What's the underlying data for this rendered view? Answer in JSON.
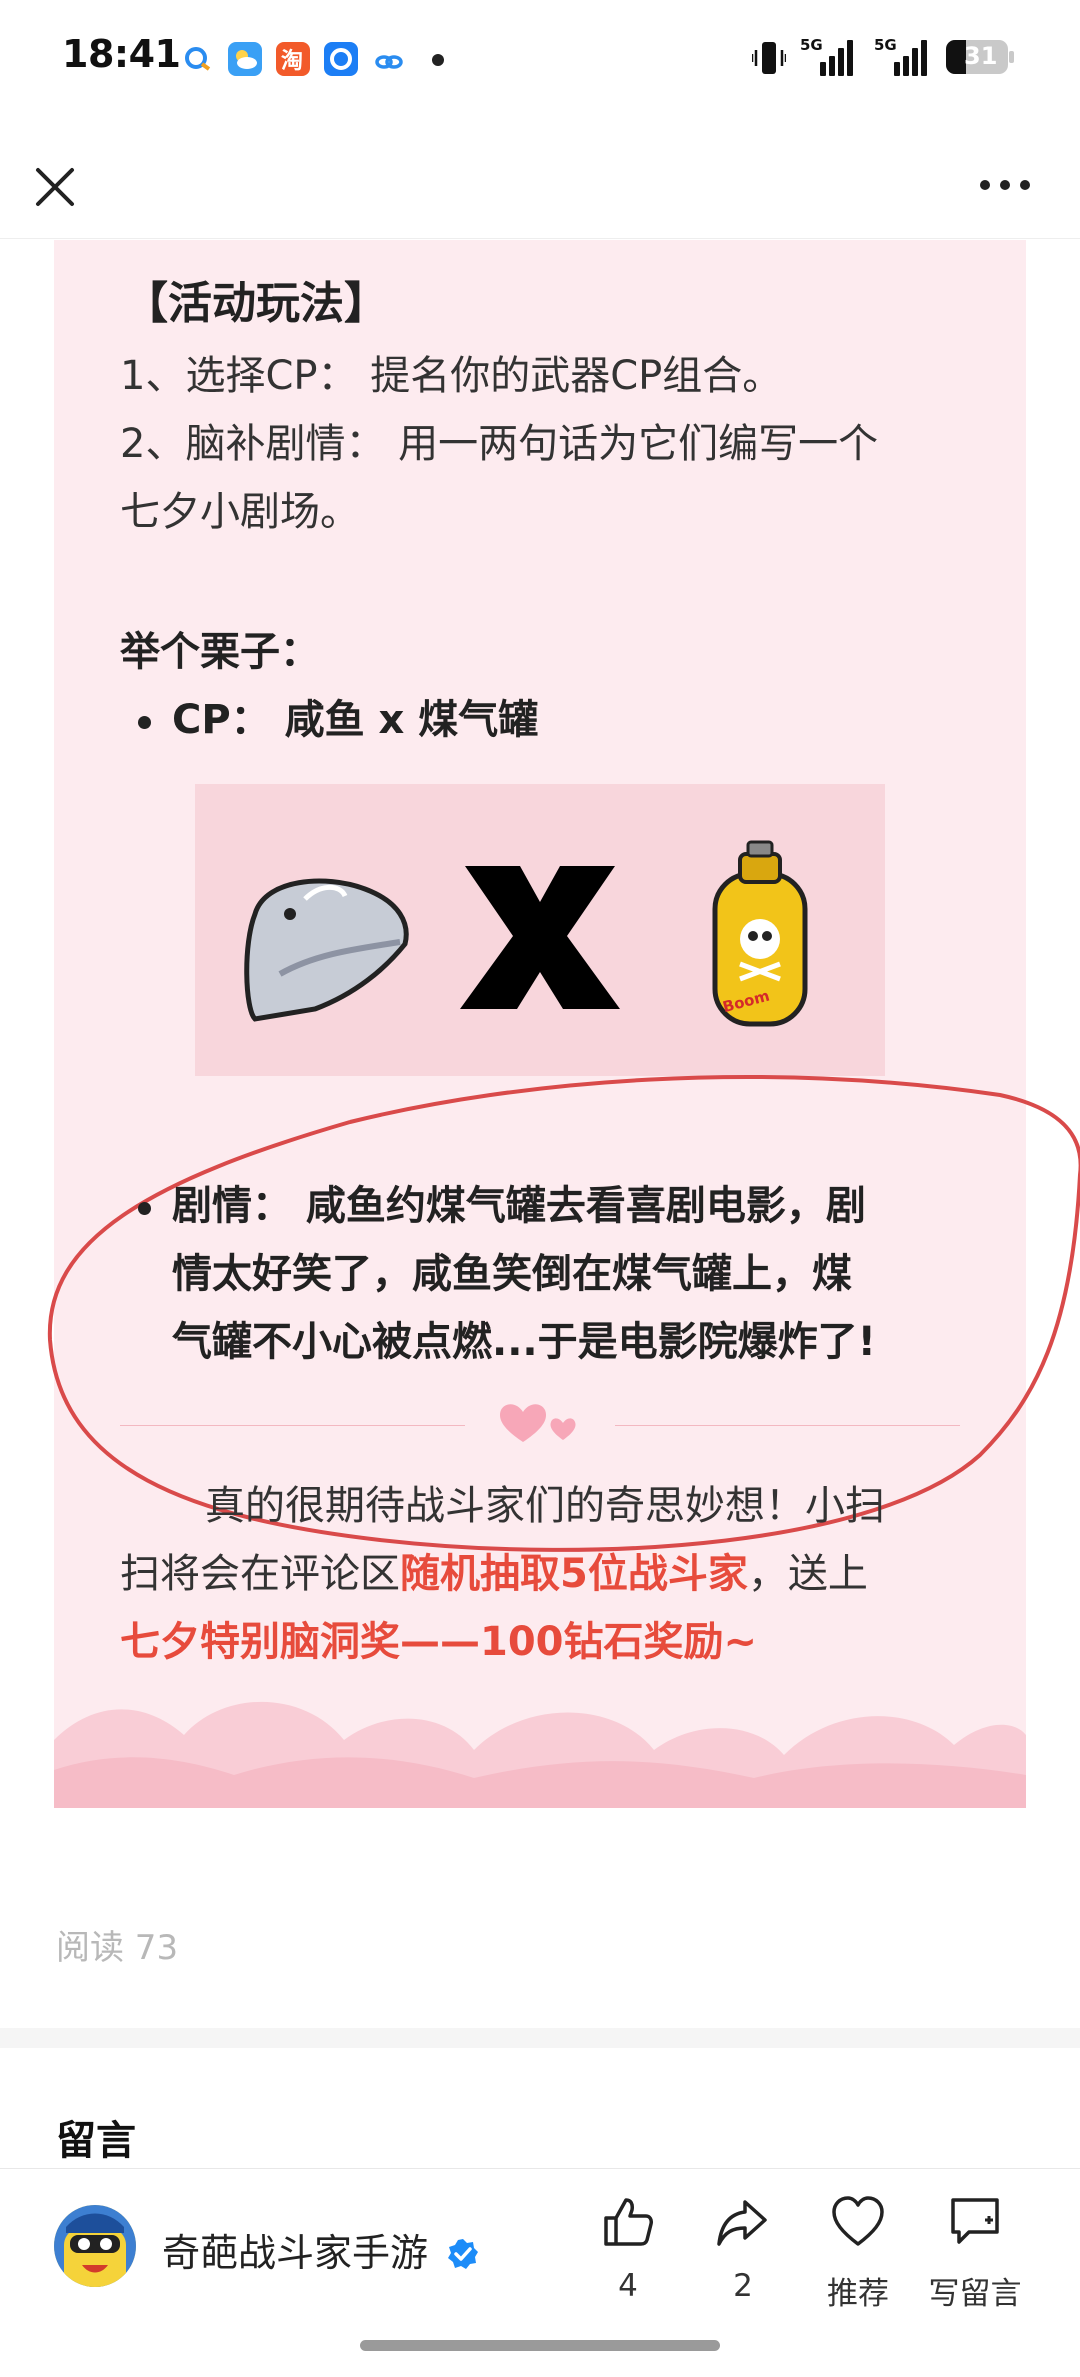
{
  "status_bar": {
    "time": "18:41",
    "network": "5G",
    "battery": "31",
    "icons": [
      "qq-icon",
      "weather-icon",
      "taobao-icon",
      "browser-icon",
      "link-icon"
    ]
  },
  "nav": {
    "close_icon": "close-icon",
    "more_icon": "more-icon"
  },
  "article": {
    "section_title": "【活动玩法】",
    "step1": "1、选择CP： 提名你的武器CP组合。",
    "step2_line1": "2、脑补剧情： 用一两句话为它们编写一个",
    "step2_line2": "七夕小剧场。",
    "example_title": "举个栗子：",
    "cp_label": "CP： 咸鱼 x 煤气罐",
    "cp_icons": [
      "salted-fish-icon",
      "x-icon",
      "gas-tank-icon"
    ],
    "gas_tank_text": "Boom",
    "plot_line1": "剧情： 咸鱼约煤气罐去看喜剧电影，剧",
    "plot_line2": "情太好笑了，咸鱼笑倒在煤气罐上，煤",
    "plot_line3": "气罐不小心被点燃...于是电影院爆炸了!",
    "closing_line1": "真的很期待战斗家们的奇思妙想！小扫",
    "closing_line2_pre": "扫将会在评论区",
    "closing_line2_red": "随机抽取5位战斗家",
    "closing_line2_post": "，送上",
    "closing_line3_red": "七夕特别脑洞奖——100钻石奖励~"
  },
  "read_count": "阅读 73",
  "comments_title": "留言",
  "bottom_bar": {
    "account_name": "奇葩战斗家手游",
    "like_count": "4",
    "share_count": "2",
    "recommend_label": "推荐",
    "write_comment_label": "写留言"
  },
  "colors": {
    "card_bg": "#fdebef",
    "accent_red": "#e74b3c",
    "verified_blue": "#1d8cf8"
  }
}
